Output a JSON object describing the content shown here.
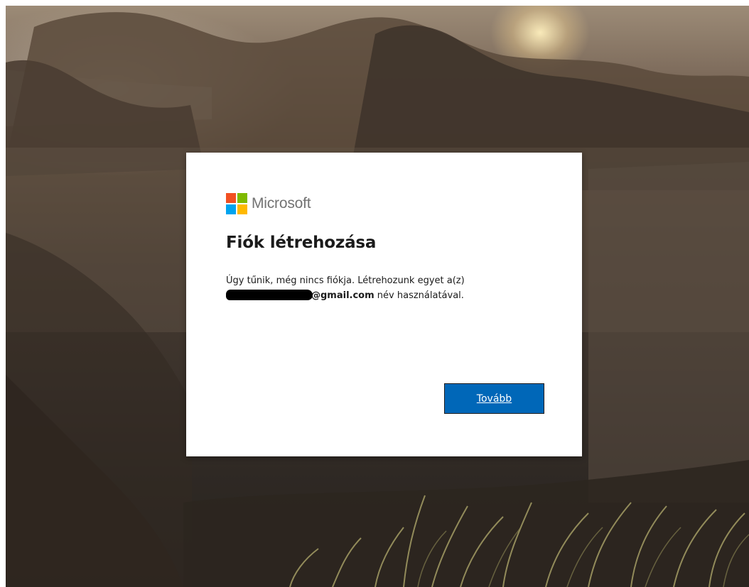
{
  "brand": {
    "name": "Microsoft",
    "logo_colors": [
      "#f25022",
      "#7fba00",
      "#00a4ef",
      "#ffb900"
    ]
  },
  "dialog": {
    "title": "Fiók létrehozása",
    "message_line1": "Úgy tűnik, még nincs fiókja. Létrehozunk egyet a(z)",
    "email_domain": "@gmail.com",
    "message_suffix": " név használatával.",
    "next_button": "Tovább"
  },
  "colors": {
    "button_bg": "#0067b8",
    "text": "#1b1b1b",
    "logo_text": "#737373"
  }
}
